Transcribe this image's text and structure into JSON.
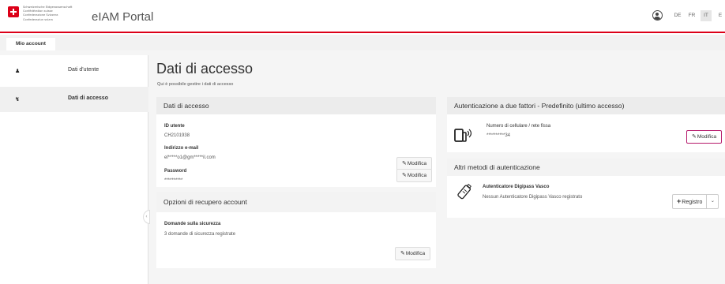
{
  "header": {
    "confederation_lines": [
      "Schweizerische Eidgenossenschaft",
      "Confédération suisse",
      "Confederazione Svizzera",
      "Confederaziun svizra"
    ],
    "app_title": "eIAM Portal",
    "languages": [
      "DE",
      "FR",
      "IT",
      "E"
    ],
    "active_language": "IT"
  },
  "tabs": {
    "account": "Mio account"
  },
  "sidebar": {
    "items": [
      {
        "label": "Dati d'utente",
        "icon": "user-icon"
      },
      {
        "label": "Dati di accesso",
        "icon": "key-icon"
      }
    ]
  },
  "main": {
    "title": "Dati di accesso",
    "subtitle": "Qui è possibile gestire i dati di accesso"
  },
  "access_card": {
    "title": "Dati di accesso",
    "user_id_label": "ID utente",
    "user_id_value": "CH2101938",
    "email_label": "Indirizzo e-mail",
    "email_value": "el*****o1@gm*****il.com",
    "password_label": "Password",
    "password_value": "**********",
    "edit_label": "Modifica"
  },
  "recovery_card": {
    "title": "Opzioni di recupero account",
    "questions_label": "Domande sulla sicurezza",
    "questions_value": "3 domande di sicurezza registrate",
    "edit_label": "Modifica"
  },
  "twofa_card": {
    "title": "Autenticazione a due fattori - Predefinito (ultimo accesso)",
    "method_label": "Numero di cellulare / rete fissa",
    "method_value": "**********34",
    "edit_label": "Modifica"
  },
  "other_methods_card": {
    "title": "Altri metodi di autenticazione",
    "method_label": "Autenticatore Digipass Vasco",
    "method_value": "Nessun Autenticatore Digipass Vasco registrato",
    "register_label": "Registro"
  },
  "colors": {
    "accent": "#dc0018",
    "focus": "#b5186b"
  }
}
